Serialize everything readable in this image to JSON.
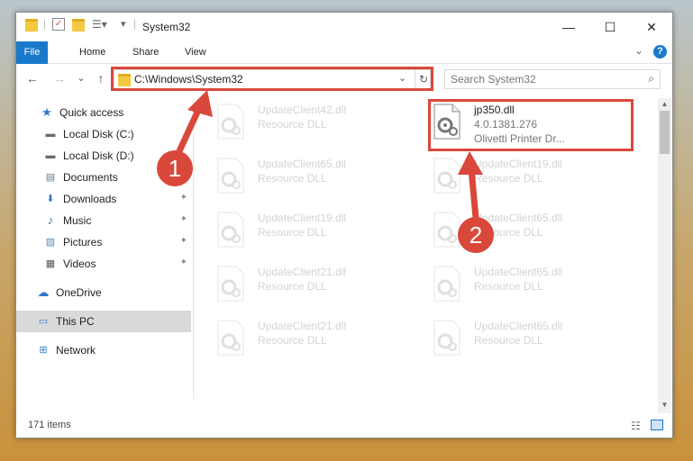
{
  "window": {
    "title": "System32",
    "minimize_glyph": "—",
    "maximize_glyph": "☐",
    "close_glyph": "✕"
  },
  "ribbon": {
    "tabs": [
      "File",
      "Home",
      "Share",
      "View"
    ],
    "help_glyph": "?",
    "expand_glyph": "⌄"
  },
  "nav": {
    "back_glyph": "←",
    "forward_glyph": "→",
    "recent_glyph": "⌄",
    "up_glyph": "↑",
    "address": "C:\\Windows\\System32",
    "address_chevron": "⌄",
    "refresh_glyph": "↻",
    "search_placeholder": "Search System32",
    "search_glyph": "⌕"
  },
  "sidebar": {
    "items": [
      {
        "label": "Quick access",
        "icon": "star-icon",
        "glyph": "★",
        "color": "#2f79c9"
      },
      {
        "label": "Local Disk (C:)",
        "icon": "drive-icon",
        "glyph": "▬",
        "color": "#6b6b6b"
      },
      {
        "label": "Local Disk (D:)",
        "icon": "drive-icon",
        "glyph": "▬",
        "color": "#6b6b6b"
      },
      {
        "label": "Documents",
        "icon": "documents-icon",
        "glyph": "▤",
        "color": "#6b7c90"
      },
      {
        "label": "Downloads",
        "icon": "download-icon",
        "glyph": "⬇",
        "color": "#2f79c9"
      },
      {
        "label": "Music",
        "icon": "music-icon",
        "glyph": "♪",
        "color": "#2f79c9"
      },
      {
        "label": "Pictures",
        "icon": "pictures-icon",
        "glyph": "▨",
        "color": "#5a8bb8"
      },
      {
        "label": "Videos",
        "icon": "videos-icon",
        "glyph": "▦",
        "color": "#555555"
      },
      {
        "label": "OneDrive",
        "icon": "cloud-icon",
        "glyph": "☁",
        "color": "#2f79c9"
      },
      {
        "label": "This PC",
        "icon": "computer-icon",
        "glyph": "▭",
        "color": "#2f79c9"
      },
      {
        "label": "Network",
        "icon": "network-icon",
        "glyph": "⊞",
        "color": "#2f79c9"
      }
    ],
    "pin_glyph": "📌"
  },
  "files": {
    "highlighted": {
      "name": "jp350.dll",
      "version": "4.0.1381.276",
      "description": "Olivetti Printer Dr..."
    },
    "faded": [
      {
        "name": "UpdateClient42.dll",
        "type": "Resource DLL"
      },
      {
        "name": "UpdateClient65.dll",
        "type": "Resource DLL"
      },
      {
        "name": "UpdateClient19.dll",
        "type": "Resource DLL"
      },
      {
        "name": "UpdateClient19.dll",
        "type": "Resource DLL"
      },
      {
        "name": "UpdateClient65.dll",
        "type": "Resource DLL"
      },
      {
        "name": "UpdateClient21.dll",
        "type": "Resource DLL"
      },
      {
        "name": "UpdateClient65.dll",
        "type": "Resource DLL"
      },
      {
        "name": "UpdateClient21.dll",
        "type": "Resource DLL"
      },
      {
        "name": "UpdateClient65.dll",
        "type": "Resource DLL"
      }
    ]
  },
  "status": {
    "items_count": "171 items"
  },
  "annotations": {
    "step1": "1",
    "step2": "2",
    "color": "#d9483b"
  }
}
